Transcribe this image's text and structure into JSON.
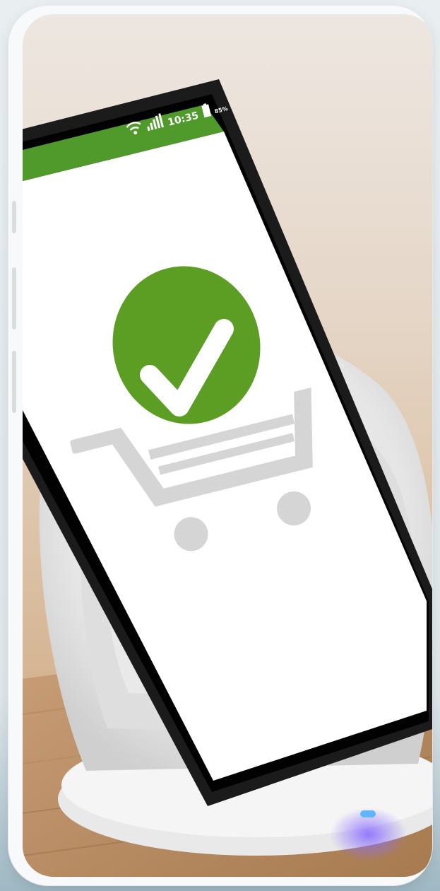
{
  "status_bar": {
    "time": "10:35",
    "battery": "85%",
    "wifi_icon": "wifi-icon",
    "signal_icon": "signal-icon",
    "battery_icon": "battery-icon"
  },
  "app_screen": {
    "header_color": "#4f9a2b",
    "check_color": "#5c9e24",
    "cart_color": "#d5d5d5",
    "status": "purchase-success",
    "illustration_icons": [
      "check-circle-icon",
      "shopping-cart-icon"
    ]
  },
  "device_frame_color": "#f7f9fa",
  "led_color": "#4aa3ff"
}
